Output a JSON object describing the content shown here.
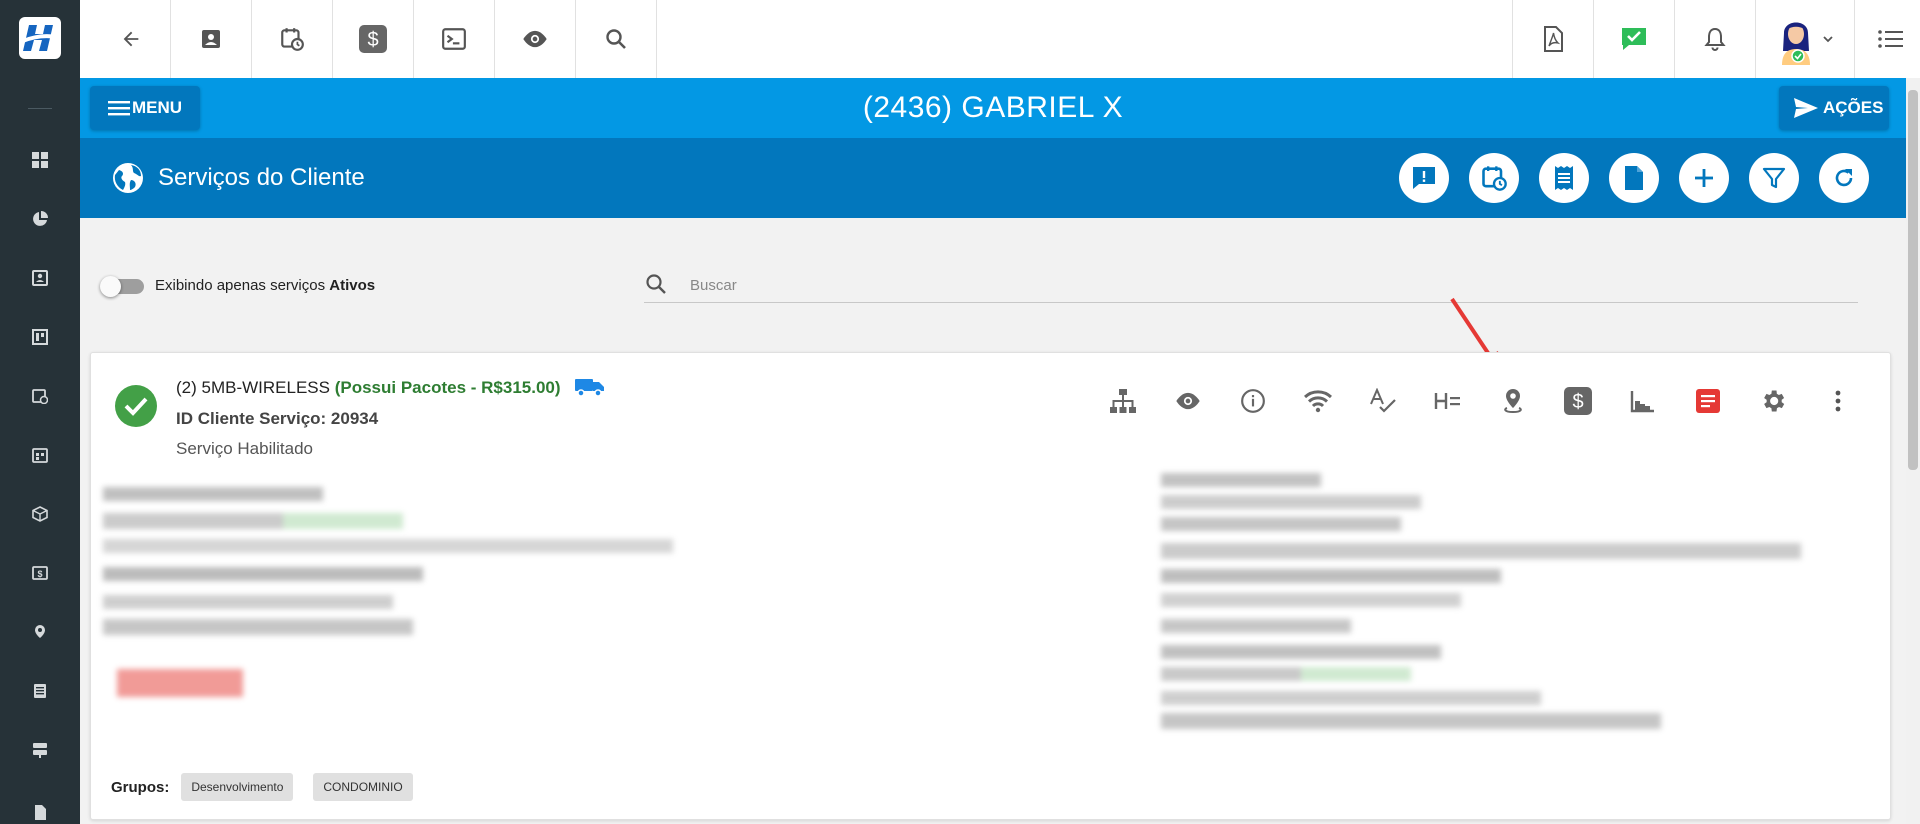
{
  "topbar": {
    "icons": [
      "back-arrow-icon",
      "contact-card-icon",
      "calendar-clock-icon",
      "dollar-icon",
      "terminal-icon",
      "eye-icon",
      "search-icon",
      "pdf-icon",
      "chat-check-icon",
      "bell-icon",
      "avatar",
      "chevron-down-icon",
      "list-icon"
    ]
  },
  "header": {
    "menu_label": "MENU",
    "client_title": "(2436) GABRIEL X",
    "actions_label": "AÇÕES"
  },
  "section": {
    "title": "Serviços do Cliente",
    "buttons": [
      "alert-chat-icon",
      "calendar-clock-icon",
      "receipt-icon",
      "document-icon",
      "add-icon",
      "filter-icon",
      "refresh-icon"
    ]
  },
  "filters": {
    "toggle_label_prefix": "Exibindo apenas serviços ",
    "toggle_label_bold": "Ativos",
    "search_placeholder": "Buscar"
  },
  "service": {
    "name": "(2) 5MB-WIRELESS",
    "package": "(Possui Pacotes - R$315.00)",
    "id_line": "ID Cliente Serviço: 20934",
    "status": "Serviço Habilitado",
    "groups_label": "Grupos:",
    "groups": [
      "Desenvolvimento",
      "CONDOMINIO"
    ],
    "actions": [
      "network-tree-icon",
      "eye-icon",
      "info-icon",
      "wifi-icon",
      "spellcheck-icon",
      "format-icon",
      "location-pin-icon",
      "dollar-icon",
      "bar-chart-icon",
      "document-red-icon",
      "gear-icon",
      "more-vert-icon"
    ]
  },
  "colors": {
    "sidebar": "#263238",
    "blue_light": "#0398e4",
    "blue_dark": "#0277bd",
    "success": "#43a047",
    "package_green": "#2e7d32",
    "annotation_red": "#e53935"
  }
}
